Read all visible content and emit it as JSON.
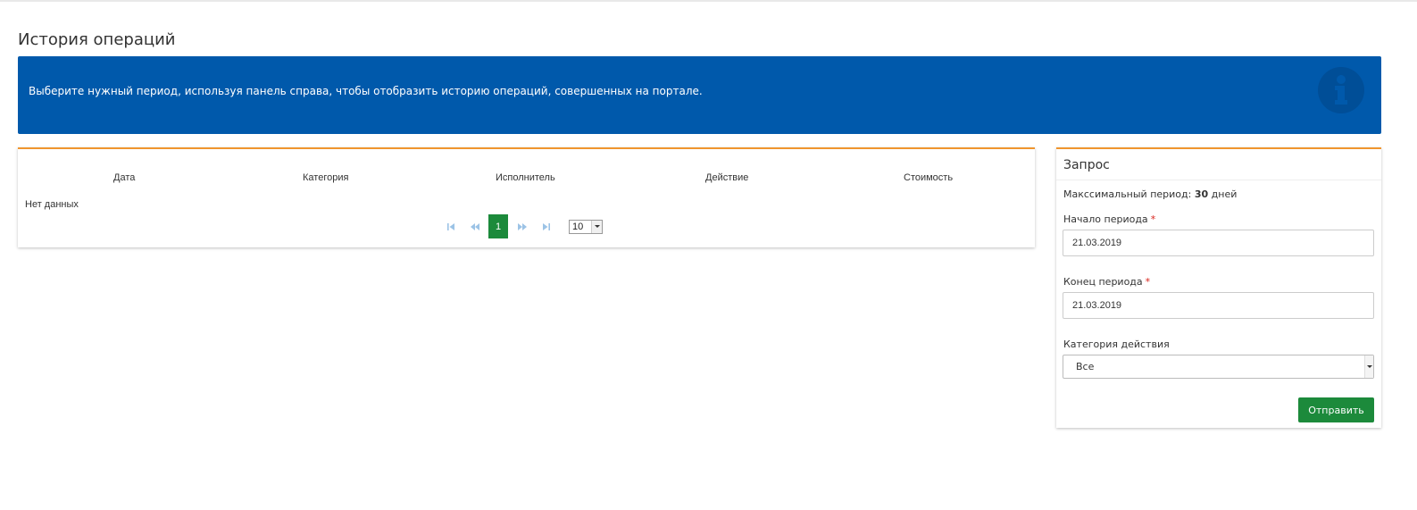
{
  "page": {
    "title": "История операций"
  },
  "info_banner": {
    "text": "Выберите нужный период, используя панель справа, чтобы отобразить историю операций, совершенных на портале.",
    "icon": "info-circle-icon",
    "background": "#0059ab"
  },
  "table": {
    "columns": [
      "Дата",
      "Категория",
      "Исполнитель",
      "Действие",
      "Стоимость"
    ],
    "empty_text": "Нет данных",
    "pager": {
      "current_page": "1",
      "page_size": "10",
      "icons": [
        "first-page-icon",
        "prev-page-icon",
        "next-page-icon",
        "last-page-icon"
      ]
    }
  },
  "query": {
    "title": "Запрос",
    "max_period_label": "Максcимальный период:",
    "max_period_value": "30",
    "max_period_unit": "дней",
    "start_label": "Начало периода",
    "start_value": "21.03.2019",
    "end_label": "Конец периода",
    "end_value": "21.03.2019",
    "required_mark": "*",
    "category_label": "Категория действия",
    "category_value": "Все",
    "submit_label": "Отправить"
  },
  "colors": {
    "accent_orange": "#f0952e",
    "button_green": "#1c8a3b",
    "required_red": "#d9251d"
  }
}
